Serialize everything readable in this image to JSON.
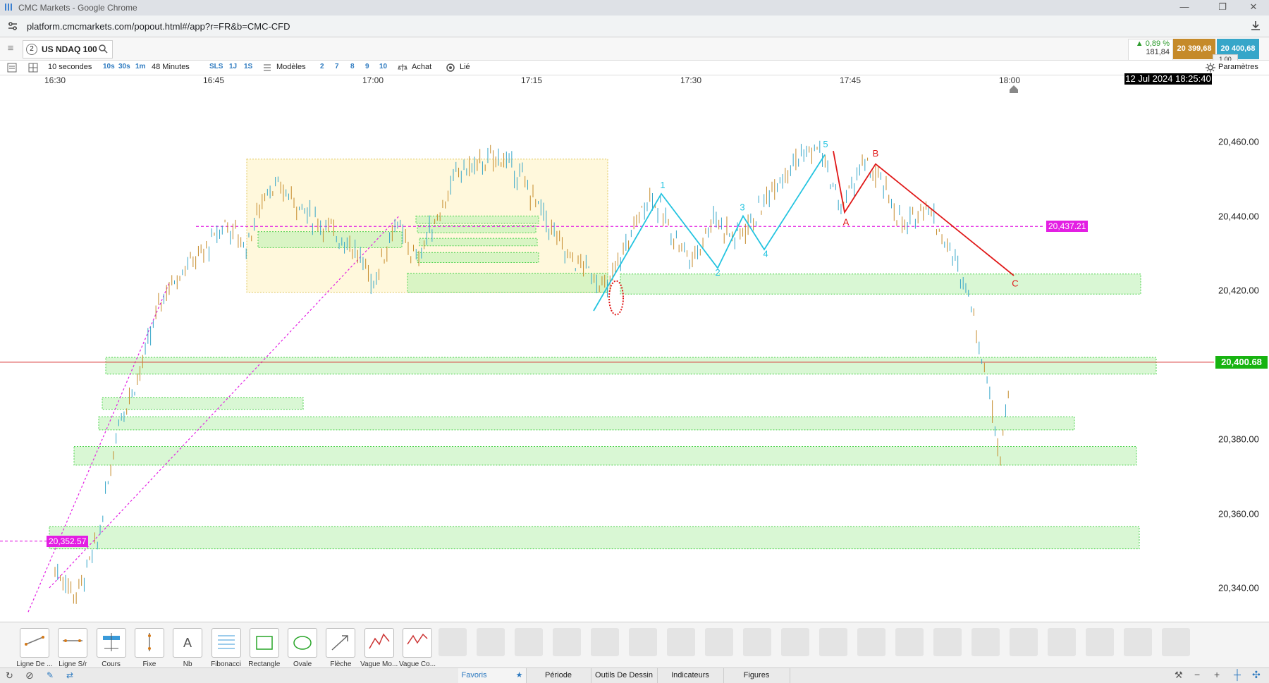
{
  "browser": {
    "window_title": "CMC Markets - Google Chrome",
    "url": "platform.cmcmarkets.com/popout.html#/app?r=FR&b=CMC-CFD"
  },
  "header": {
    "instrument_number": "2",
    "instrument_name": "US NDAQ 100",
    "change_pct": "▲ 0,89 %",
    "change_pts": "181,84",
    "sell_price": "20 399,68",
    "buy_price": "20 400,68",
    "spread": "1.00"
  },
  "toolbar": {
    "interval": "10 secondes",
    "quick_intervals": [
      "10s",
      "30s",
      "1m"
    ],
    "range": "48 Minutes",
    "range_options": [
      "SLS",
      "1J",
      "1S"
    ],
    "models_label": "Modèles",
    "model_options": [
      "2",
      "7",
      "8",
      "9",
      "10"
    ],
    "achat_label": "Achat",
    "lie_label": "Lié",
    "params_label": "Paramètres"
  },
  "time_axis": {
    "labels": [
      "16:30",
      "16:45",
      "17:00",
      "17:15",
      "17:30",
      "17:45",
      "18:00"
    ],
    "current_datetime": "12 Jul 2024 18:25:40"
  },
  "chart_data": {
    "type": "candlestick",
    "instrument": "US NDAQ 100",
    "interval": "10 secondes",
    "price_axis_labels": [
      "20,460.00",
      "20,440.00",
      "20,420.00",
      "20,380.00",
      "20,360.00",
      "20,340.00"
    ],
    "price_ticks": [
      20460,
      20440,
      20420,
      20380,
      20360,
      20340
    ],
    "ylim": [
      20333,
      20475
    ],
    "current_price": 20400.68,
    "current_price_label": "20,400.68",
    "horizontal_lines": [
      {
        "label": "20,437.21",
        "value": 20437.21,
        "color": "#e31fe3"
      },
      {
        "label": "20,352.57",
        "value": 20352.57,
        "color": "#e31fe3"
      }
    ],
    "wave_labels_cyan": [
      "1",
      "2",
      "3",
      "4",
      "5"
    ],
    "wave_labels_red": [
      "A",
      "B",
      "C"
    ],
    "time_ticks": [
      "16:30",
      "16:45",
      "17:00",
      "17:15",
      "17:30",
      "17:45",
      "18:00"
    ],
    "price_path": [
      {
        "t": "16:30",
        "p": 20345
      },
      {
        "t": "16:32",
        "p": 20338
      },
      {
        "t": "16:34",
        "p": 20352
      },
      {
        "t": "16:36",
        "p": 20385
      },
      {
        "t": "16:38",
        "p": 20398
      },
      {
        "t": "16:40",
        "p": 20418
      },
      {
        "t": "16:42",
        "p": 20426
      },
      {
        "t": "16:44",
        "p": 20430
      },
      {
        "t": "16:46",
        "p": 20438
      },
      {
        "t": "16:48",
        "p": 20432
      },
      {
        "t": "16:50",
        "p": 20448
      },
      {
        "t": "16:52",
        "p": 20446
      },
      {
        "t": "16:54",
        "p": 20440
      },
      {
        "t": "16:56",
        "p": 20436
      },
      {
        "t": "16:58",
        "p": 20432
      },
      {
        "t": "17:00",
        "p": 20422
      },
      {
        "t": "17:02",
        "p": 20438
      },
      {
        "t": "17:04",
        "p": 20428
      },
      {
        "t": "17:06",
        "p": 20440
      },
      {
        "t": "17:08",
        "p": 20452
      },
      {
        "t": "17:10",
        "p": 20454
      },
      {
        "t": "17:12",
        "p": 20456
      },
      {
        "t": "17:14",
        "p": 20450
      },
      {
        "t": "17:16",
        "p": 20440
      },
      {
        "t": "17:18",
        "p": 20430
      },
      {
        "t": "17:20",
        "p": 20426
      },
      {
        "t": "17:22",
        "p": 20420
      },
      {
        "t": "17:24",
        "p": 20434
      },
      {
        "t": "17:26",
        "p": 20446
      },
      {
        "t": "17:28",
        "p": 20436
      },
      {
        "t": "17:30",
        "p": 20428
      },
      {
        "t": "17:32",
        "p": 20440
      },
      {
        "t": "17:34",
        "p": 20434
      },
      {
        "t": "17:36",
        "p": 20440
      },
      {
        "t": "17:38",
        "p": 20450
      },
      {
        "t": "17:40",
        "p": 20456
      },
      {
        "t": "17:42",
        "p": 20458
      },
      {
        "t": "17:44",
        "p": 20442
      },
      {
        "t": "17:46",
        "p": 20454
      },
      {
        "t": "17:48",
        "p": 20448
      },
      {
        "t": "17:50",
        "p": 20436
      },
      {
        "t": "17:52",
        "p": 20444
      },
      {
        "t": "17:54",
        "p": 20432
      },
      {
        "t": "17:56",
        "p": 20420
      },
      {
        "t": "17:58",
        "p": 20392
      },
      {
        "t": "17:59",
        "p": 20376
      },
      {
        "t": "18:00",
        "p": 20400
      }
    ]
  },
  "drawing_tools": [
    {
      "label": "Ligne De ...",
      "icon": "line-icon"
    },
    {
      "label": "Ligne S/r",
      "icon": "sr-line-icon"
    },
    {
      "label": "Cours",
      "icon": "price-icon"
    },
    {
      "label": "Fixe",
      "icon": "fixed-icon"
    },
    {
      "label": "Nb",
      "icon": "text-icon"
    },
    {
      "label": "Fibonacci",
      "icon": "fibonacci-icon"
    },
    {
      "label": "Rectangle",
      "icon": "rectangle-icon"
    },
    {
      "label": "Ovale",
      "icon": "oval-icon"
    },
    {
      "label": "Flèche",
      "icon": "arrow-icon"
    },
    {
      "label": "Vague Mo...",
      "icon": "wave-icon"
    },
    {
      "label": "Vague Co...",
      "icon": "corrective-wave-icon"
    }
  ],
  "bottom_tabs": [
    "Favoris",
    "Période",
    "Outils De Dessin",
    "Indicateurs",
    "Figures"
  ],
  "colors": {
    "sell": "#c58a2a",
    "buy": "#36a6c9",
    "current_price": "#17b310",
    "level_line": "#e31fe3",
    "wave_impulse": "#24c4e0",
    "wave_corrective": "#e01818"
  }
}
